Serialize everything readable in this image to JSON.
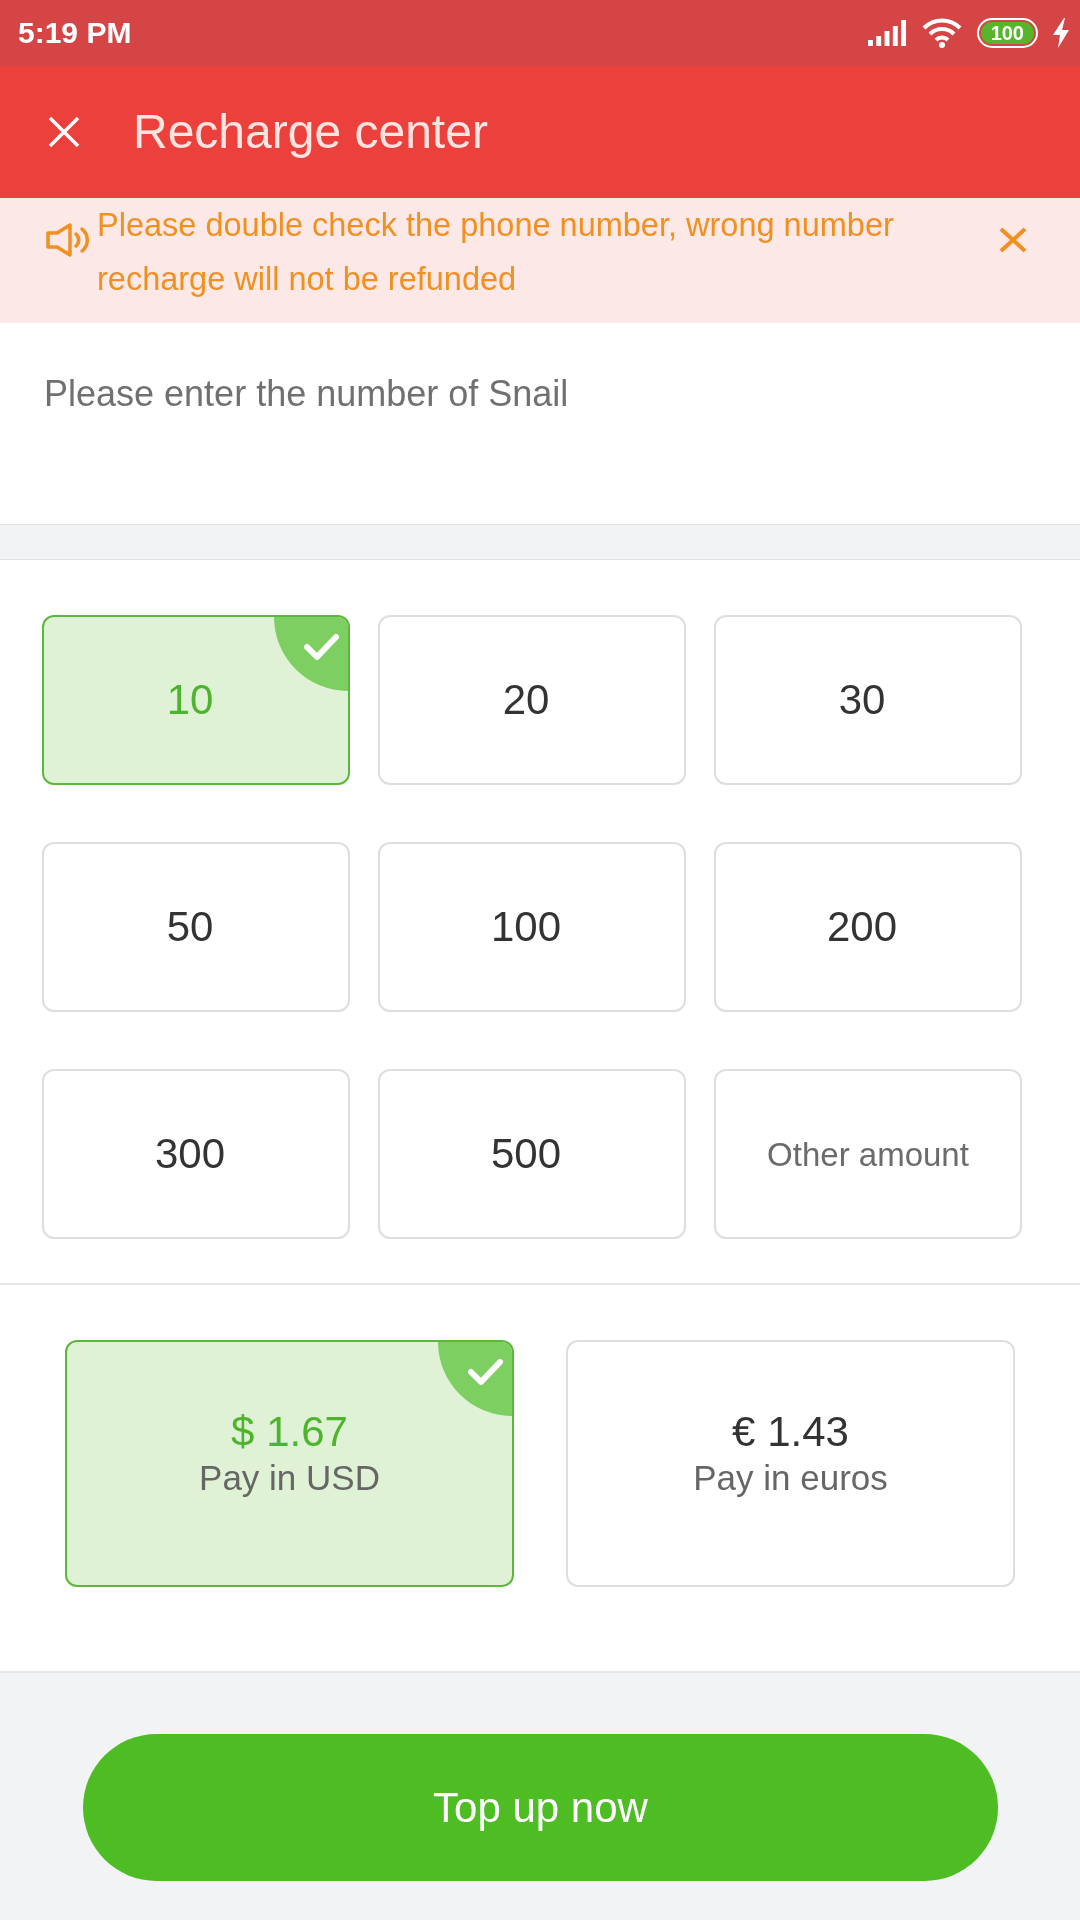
{
  "status_bar": {
    "time": "5:19 PM",
    "battery": "100"
  },
  "header": {
    "title": "Recharge center"
  },
  "notice": {
    "text": "Please double check the phone number, wrong number recharge will not be refunded"
  },
  "phone_field": {
    "placeholder": "Please enter the number of Snail"
  },
  "amounts": [
    {
      "label": "10",
      "kind": "amount",
      "selected": true
    },
    {
      "label": "20",
      "kind": "amount",
      "selected": false
    },
    {
      "label": "30",
      "kind": "amount",
      "selected": false
    },
    {
      "label": "50",
      "kind": "amount",
      "selected": false
    },
    {
      "label": "100",
      "kind": "amount",
      "selected": false
    },
    {
      "label": "200",
      "kind": "amount",
      "selected": false
    },
    {
      "label": "300",
      "kind": "amount",
      "selected": false
    },
    {
      "label": "500",
      "kind": "amount",
      "selected": false
    },
    {
      "label": "Other amount",
      "kind": "custom",
      "selected": false
    }
  ],
  "payment_options": [
    {
      "price": "$ 1.67",
      "label": "Pay in USD",
      "selected": true
    },
    {
      "price": "€ 1.43",
      "label": "Pay in euros",
      "selected": false
    }
  ],
  "submit_button": {
    "label": "Top up now"
  }
}
